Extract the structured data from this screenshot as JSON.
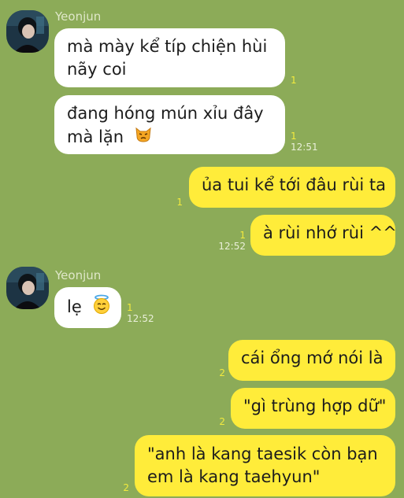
{
  "chat": {
    "sender_name": "Yeonjun",
    "messages": [
      {
        "side": "in",
        "text": "mà mày kể típ chiện hùi nãy coi",
        "line1": "mà mày kể típ chiện hùi",
        "line2": "nãy coi",
        "unread": "1",
        "time": ""
      },
      {
        "side": "in",
        "text": "đang hóng mún xỉu đây mà lặn",
        "line1": "đang hóng mún xỉu đây",
        "line2": "mà lặn",
        "emoji": "cat-face-emoji",
        "unread": "1",
        "time": "12:51"
      },
      {
        "side": "out",
        "text": "ủa tui kể tới đâu rùi ta",
        "unread": "1",
        "time": ""
      },
      {
        "side": "out",
        "text": "à rùi nhớ rùi ^^",
        "unread": "1",
        "time": "12:52"
      },
      {
        "side": "in",
        "text": "lẹ",
        "emoji": "smiling-face-with-halo-emoji",
        "unread": "1",
        "time": "12:52"
      },
      {
        "side": "out",
        "text": "cái ổng mớ nói là",
        "unread": "2",
        "time": ""
      },
      {
        "side": "out",
        "text": "\"gì trùng hợp dữ\"",
        "unread": "2",
        "time": ""
      },
      {
        "side": "out",
        "text": "\"anh là kang taesik còn bạn em là kang taehyun\"",
        "line1": "\"anh là kang taesik còn bạn",
        "line2": "em là kang taehyun\"",
        "unread": "2",
        "time": ""
      }
    ]
  },
  "colors": {
    "background": "#8cab58",
    "incoming_bubble": "#ffffff",
    "outgoing_bubble": "#ffec3a",
    "unread_count": "#f2ea3e"
  }
}
